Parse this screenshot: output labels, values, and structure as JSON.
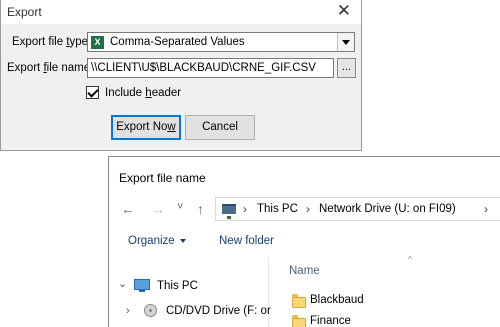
{
  "export_dialog": {
    "title": "Export",
    "close_symbol": "✕",
    "file_type_label_pre": "Export file ",
    "file_type_label_u": "t",
    "file_type_label_post": "ype:",
    "file_type_value": "Comma-Separated Values",
    "file_type_icon": "excel-icon",
    "file_type_icon_glyph": "X",
    "file_name_label_pre": "Export ",
    "file_name_label_u": "f",
    "file_name_label_post": "ile name:",
    "file_name_value": "\\\\CLIENT\\U$\\BLACKBAUD\\CRNE_GIF.CSV",
    "browse_label": "...",
    "include_header_pre": "Include ",
    "include_header_u": "h",
    "include_header_post": "eader",
    "include_header_checked": true,
    "export_now_pre": "Export No",
    "export_now_u": "w",
    "cancel_label": "Cancel"
  },
  "file_dialog": {
    "title": "Export file name",
    "nav": {
      "back_glyph": "←",
      "forward_glyph": "→",
      "recent_glyph": "˅",
      "up_glyph": "↑",
      "location_icon": "network-drive-icon"
    },
    "breadcrumbs": [
      {
        "label": "This PC"
      },
      {
        "label": "Network Drive (U: on FI09)"
      }
    ],
    "crumb_sep": "›",
    "toolbar": {
      "organize_label": "Organize",
      "new_folder_label": "New folder"
    },
    "column_header": "Name",
    "sort_glyph": "^",
    "tree": [
      {
        "label": "This PC",
        "expanded": true,
        "chevron": "⌄",
        "icon": "computer-icon"
      },
      {
        "label": "CD/DVD Drive (F: or",
        "expanded": false,
        "chevron": "›",
        "icon": "cd-drive-icon"
      }
    ],
    "files": [
      {
        "name": "Blackbaud",
        "type": "folder"
      },
      {
        "name": "Finance",
        "type": "folder"
      }
    ]
  }
}
